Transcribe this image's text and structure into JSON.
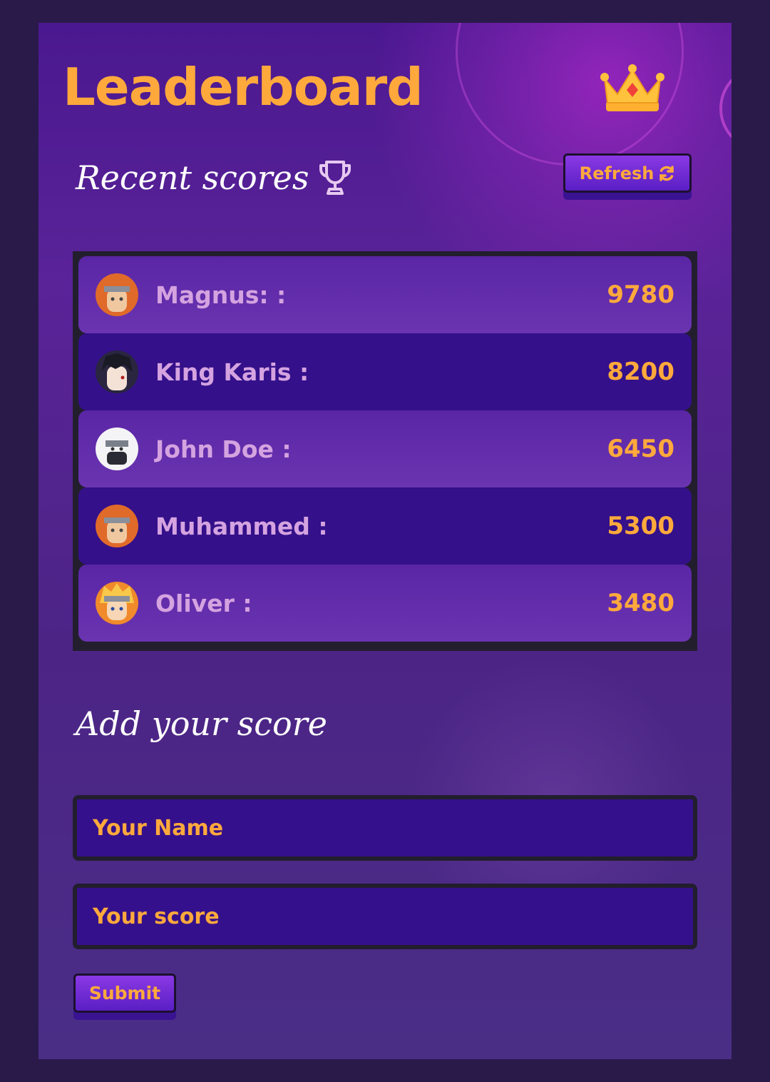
{
  "header": {
    "title": "Leaderboard",
    "icon": "crown-icon"
  },
  "recent": {
    "heading": "Recent scores",
    "icon": "trophy-icon",
    "refresh_label": "Refresh"
  },
  "scores": [
    {
      "name": "Magnus: :",
      "score": "9780",
      "avatar": "orange-haired-ninja"
    },
    {
      "name": "King Karis :",
      "score": "8200",
      "avatar": "dark-haired-ninja"
    },
    {
      "name": "John Doe :",
      "score": "6450",
      "avatar": "masked-silver-haired-ninja"
    },
    {
      "name": "Muhammed :",
      "score": "5300",
      "avatar": "orange-haired-ninja"
    },
    {
      "name": "Oliver :",
      "score": "3480",
      "avatar": "blond-ninja"
    }
  ],
  "form": {
    "heading": "Add your score",
    "name_placeholder": "Your Name",
    "score_placeholder": "Your score",
    "submit_label": "Submit"
  },
  "colors": {
    "accent": "#ffa93c",
    "frame": "#2a1a4a",
    "row_dark": "#34108a",
    "row_light": "#5a26a6",
    "name_text": "#d4a3e0"
  }
}
